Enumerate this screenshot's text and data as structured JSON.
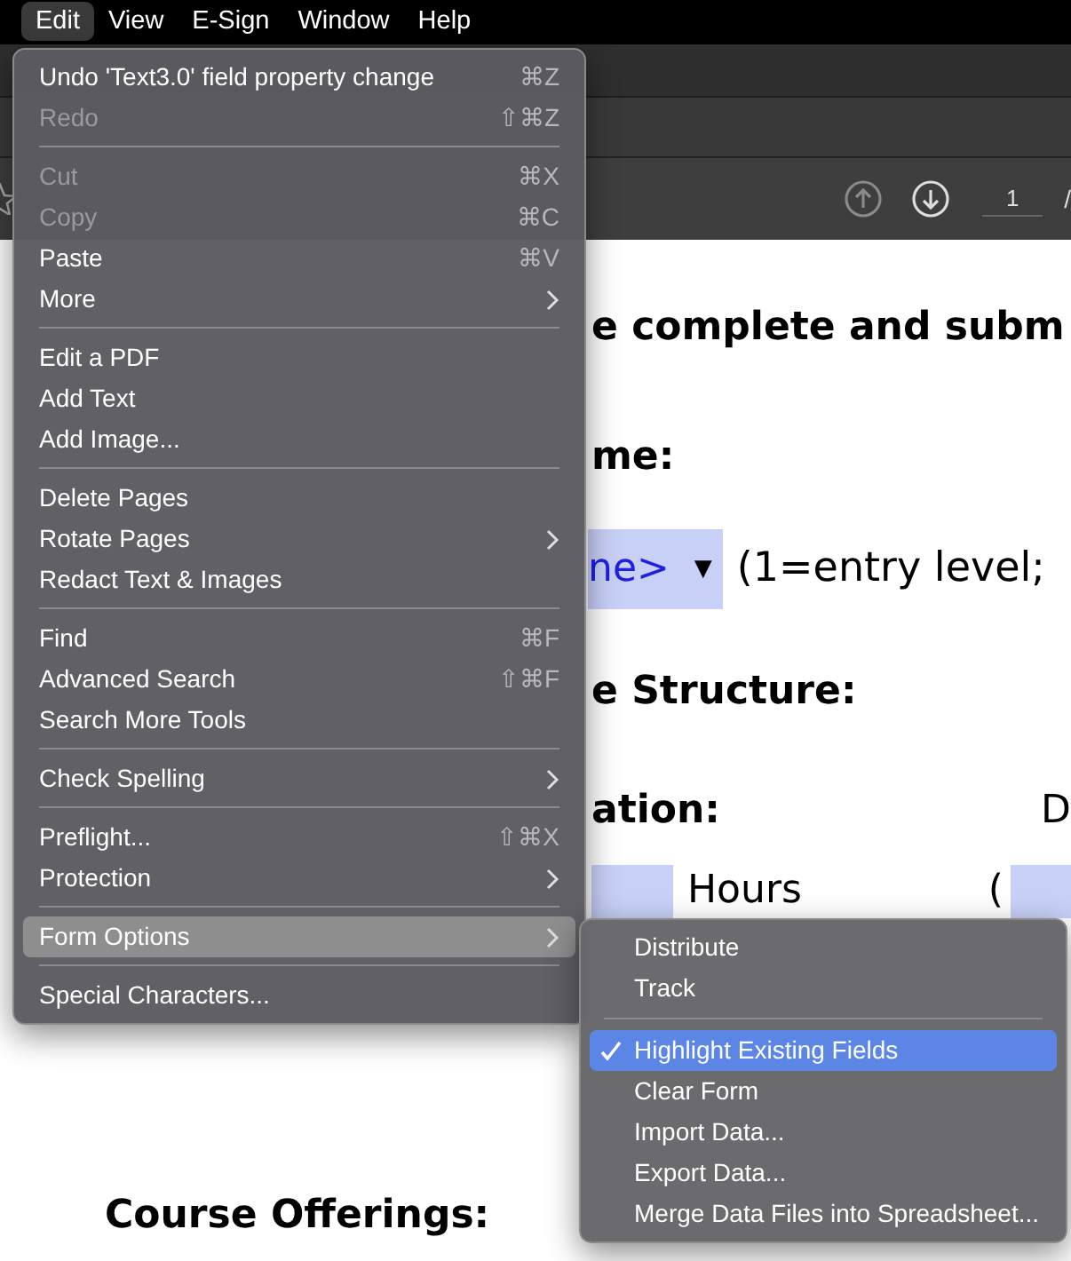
{
  "menubar": [
    {
      "label": "Edit",
      "selected": true
    },
    {
      "label": "View",
      "selected": false
    },
    {
      "label": "E-Sign",
      "selected": false
    },
    {
      "label": "Window",
      "selected": false
    },
    {
      "label": "Help",
      "selected": false
    }
  ],
  "toolbar": {
    "page_number": "1",
    "page_separator": "/"
  },
  "document": {
    "lines": [
      {
        "kind": "heading",
        "text": "e complete and subm"
      },
      {
        "kind": "heading",
        "text": "me:"
      },
      {
        "kind": "dropdown",
        "value": "ne>",
        "arrow": "▼",
        "after": "(1=entry level;"
      },
      {
        "kind": "heading",
        "text": "e Structure:"
      },
      {
        "kind": "heading_right",
        "text": "ation:",
        "right": "D"
      },
      {
        "kind": "hours",
        "text": "Hours",
        "right": "("
      },
      {
        "kind": "course",
        "text": "Course Offerings:"
      }
    ]
  },
  "edit_menu": [
    {
      "kind": "item",
      "label": "Undo 'Text3.0' field property change",
      "shortcut": "⌘Z",
      "disabled": false,
      "submenu": false,
      "selected": false
    },
    {
      "kind": "item",
      "label": "Redo",
      "shortcut": "⇧⌘Z",
      "disabled": true,
      "submenu": false,
      "selected": false
    },
    {
      "kind": "separator"
    },
    {
      "kind": "item",
      "label": "Cut",
      "shortcut": "⌘X",
      "disabled": true,
      "submenu": false,
      "selected": false
    },
    {
      "kind": "item",
      "label": "Copy",
      "shortcut": "⌘C",
      "disabled": true,
      "submenu": false,
      "selected": false
    },
    {
      "kind": "item",
      "label": "Paste",
      "shortcut": "⌘V",
      "disabled": false,
      "submenu": false,
      "selected": false
    },
    {
      "kind": "item",
      "label": "More",
      "disabled": false,
      "submenu": true,
      "selected": false
    },
    {
      "kind": "separator"
    },
    {
      "kind": "item",
      "label": "Edit a PDF",
      "disabled": false,
      "submenu": false,
      "selected": false
    },
    {
      "kind": "item",
      "label": "Add Text",
      "disabled": false,
      "submenu": false,
      "selected": false
    },
    {
      "kind": "item",
      "label": "Add Image...",
      "disabled": false,
      "submenu": false,
      "selected": false
    },
    {
      "kind": "separator"
    },
    {
      "kind": "item",
      "label": "Delete Pages",
      "disabled": false,
      "submenu": false,
      "selected": false
    },
    {
      "kind": "item",
      "label": "Rotate Pages",
      "disabled": false,
      "submenu": true,
      "selected": false
    },
    {
      "kind": "item",
      "label": "Redact Text & Images",
      "disabled": false,
      "submenu": false,
      "selected": false
    },
    {
      "kind": "separator"
    },
    {
      "kind": "item",
      "label": "Find",
      "shortcut": "⌘F",
      "disabled": false,
      "submenu": false,
      "selected": false
    },
    {
      "kind": "item",
      "label": "Advanced Search",
      "shortcut": "⇧⌘F",
      "disabled": false,
      "submenu": false,
      "selected": false
    },
    {
      "kind": "item",
      "label": "Search More Tools",
      "disabled": false,
      "submenu": false,
      "selected": false
    },
    {
      "kind": "separator"
    },
    {
      "kind": "item",
      "label": "Check Spelling",
      "disabled": false,
      "submenu": true,
      "selected": false
    },
    {
      "kind": "separator"
    },
    {
      "kind": "item",
      "label": "Preflight...",
      "shortcut": "⇧⌘X",
      "disabled": false,
      "submenu": false,
      "selected": false
    },
    {
      "kind": "item",
      "label": "Protection",
      "disabled": false,
      "submenu": true,
      "selected": false
    },
    {
      "kind": "separator"
    },
    {
      "kind": "item",
      "label": "Form Options",
      "disabled": false,
      "submenu": true,
      "selected": true
    },
    {
      "kind": "separator"
    },
    {
      "kind": "item",
      "label": "Special Characters...",
      "disabled": false,
      "submenu": false,
      "selected": false
    }
  ],
  "form_options_menu": [
    {
      "kind": "item",
      "label": "Distribute",
      "checked": false,
      "selected": false
    },
    {
      "kind": "item",
      "label": "Track",
      "checked": false,
      "selected": false
    },
    {
      "kind": "separator"
    },
    {
      "kind": "item",
      "label": "Highlight Existing Fields",
      "checked": true,
      "selected": true
    },
    {
      "kind": "item",
      "label": "Clear Form",
      "checked": false,
      "selected": false
    },
    {
      "kind": "item",
      "label": "Import Data...",
      "checked": false,
      "selected": false
    },
    {
      "kind": "item",
      "label": "Export Data...",
      "checked": false,
      "selected": false
    },
    {
      "kind": "item",
      "label": "Merge Data Files into Spreadsheet...",
      "checked": false,
      "selected": false
    }
  ]
}
